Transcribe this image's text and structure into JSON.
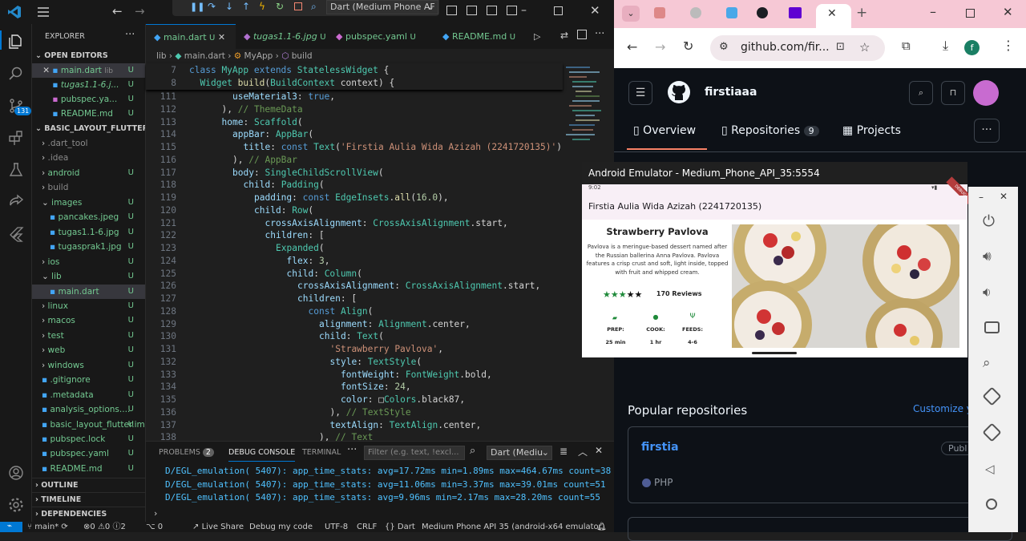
{
  "vscode": {
    "command_center": "Dart (Medium Phone AF",
    "explorer_title": "EXPLORER",
    "open_editors_label": "OPEN EDITORS",
    "open_editors": [
      {
        "name": "main.dart",
        "path": "lib",
        "status": "U"
      },
      {
        "name": "tugas1.1-6.j...",
        "path": "",
        "status": "U"
      },
      {
        "name": "pubspec.ya...",
        "path": "",
        "status": "U"
      },
      {
        "name": "README.md",
        "path": "",
        "status": "U"
      }
    ],
    "project_label": "BASIC_LAYOUT_FLUTTER",
    "tree": [
      {
        "name": ".dart_tool",
        "status": ""
      },
      {
        "name": ".idea",
        "status": ""
      },
      {
        "name": "android",
        "status": "U"
      },
      {
        "name": "build",
        "status": ""
      },
      {
        "name": "images",
        "status": "U"
      },
      {
        "name": "pancakes.jpeg",
        "status": "U"
      },
      {
        "name": "tugas1.1-6.jpg",
        "status": "U"
      },
      {
        "name": "tugasprak1.jpg",
        "status": "U"
      },
      {
        "name": "ios",
        "status": "U"
      },
      {
        "name": "lib",
        "status": "U"
      },
      {
        "name": "main.dart",
        "status": "U"
      },
      {
        "name": "linux",
        "status": "U"
      },
      {
        "name": "macos",
        "status": "U"
      },
      {
        "name": "test",
        "status": "U"
      },
      {
        "name": "web",
        "status": "U"
      },
      {
        "name": "windows",
        "status": "U"
      },
      {
        "name": ".gitignore",
        "status": "U"
      },
      {
        "name": ".metadata",
        "status": "U"
      },
      {
        "name": "analysis_options....",
        "status": "U"
      },
      {
        "name": "basic_layout_flutter.iml",
        "status": "U"
      },
      {
        "name": "pubspec.lock",
        "status": "U"
      },
      {
        "name": "pubspec.yaml",
        "status": "U"
      },
      {
        "name": "README.md",
        "status": "U"
      }
    ],
    "outline_label": "OUTLINE",
    "timeline_label": "TIMELINE",
    "dependencies_label": "DEPENDENCIES",
    "source_control_badge": "131",
    "tabs": [
      {
        "name": "main.dart",
        "status": "U"
      },
      {
        "name": "tugas1.1-6.jpg",
        "status": "U"
      },
      {
        "name": "pubspec.yaml",
        "status": "U"
      },
      {
        "name": "README.md",
        "status": "U"
      }
    ],
    "breadcrumb": [
      "lib",
      "main.dart",
      "MyApp",
      "build"
    ],
    "sticky_lines": [
      {
        "n": "7",
        "code": "class MyApp extends StatelessWidget {"
      },
      {
        "n": "8",
        "code": "  Widget build(BuildContext context) {"
      }
    ],
    "code_lines": [
      {
        "n": "111",
        "code": "        useMaterial3: true,"
      },
      {
        "n": "112",
        "code": "      ), // ThemeData"
      },
      {
        "n": "113",
        "code": "      home: Scaffold("
      },
      {
        "n": "114",
        "code": "        appBar: AppBar("
      },
      {
        "n": "115",
        "code": "          title: const Text('Firstia Aulia Wida Azizah (2241720135)'),"
      },
      {
        "n": "116",
        "code": "        ), // AppBar"
      },
      {
        "n": "117",
        "code": "        body: SingleChildScrollView("
      },
      {
        "n": "118",
        "code": "          child: Padding("
      },
      {
        "n": "119",
        "code": "            padding: const EdgeInsets.all(16.0),"
      },
      {
        "n": "120",
        "code": "            child: Row("
      },
      {
        "n": "121",
        "code": "              crossAxisAlignment: CrossAxisAlignment.start,"
      },
      {
        "n": "122",
        "code": "              children: ["
      },
      {
        "n": "123",
        "code": "                Expanded("
      },
      {
        "n": "124",
        "code": "                  flex: 3,"
      },
      {
        "n": "125",
        "code": "                  child: Column("
      },
      {
        "n": "126",
        "code": "                    crossAxisAlignment: CrossAxisAlignment.start,"
      },
      {
        "n": "127",
        "code": "                    children: ["
      },
      {
        "n": "128",
        "code": "                      const Align("
      },
      {
        "n": "129",
        "code": "                        alignment: Alignment.center,"
      },
      {
        "n": "130",
        "code": "                        child: Text("
      },
      {
        "n": "131",
        "code": "                          'Strawberry Pavlova',"
      },
      {
        "n": "132",
        "code": "                          style: TextStyle("
      },
      {
        "n": "133",
        "code": "                            fontWeight: FontWeight.bold,"
      },
      {
        "n": "134",
        "code": "                            fontSize: 24,"
      },
      {
        "n": "135",
        "code": "                            color: □Colors.black87,"
      },
      {
        "n": "136",
        "code": "                          ), // TextStyle"
      },
      {
        "n": "137",
        "code": "                          textAlign: TextAlign.center,"
      },
      {
        "n": "138",
        "code": "                        ), // Text"
      }
    ],
    "panel_tabs": [
      "PROBLEMS",
      "DEBUG CONSOLE",
      "TERMINAL"
    ],
    "problems_count": "2",
    "filter_placeholder": "Filter (e.g. text, !excl...",
    "debug_session": "Dart (Mediu",
    "console_lines": [
      "D/EGL_emulation( 5407): app_time_stats: avg=17.72ms min=1.89ms max=464.67ms count=38",
      "D/EGL_emulation( 5407): app_time_stats: avg=11.06ms min=3.37ms max=39.01ms count=51",
      "D/EGL_emulation( 5407): app_time_stats: avg=9.96ms min=2.17ms max=28.20ms count=55"
    ],
    "status": {
      "branch": "main*",
      "errors": "0",
      "warnings": "0",
      "info": "2",
      "ports": "0",
      "live_share": "Live Share",
      "debug_mode": "Debug my code",
      "encoding": "UTF-8",
      "eol": "CRLF",
      "language": "Dart",
      "device": "Medium Phone API 35 (android-x64 emulator)"
    }
  },
  "chrome": {
    "url": "github.com/fir...",
    "profile_initial": "f",
    "username": "firstiaaa",
    "nav_tabs": [
      {
        "label": "Overview",
        "count": ""
      },
      {
        "label": "Repositories",
        "count": "9"
      },
      {
        "label": "Projects",
        "count": ""
      }
    ],
    "popular_label": "Popular repositories",
    "customize_label": "Customize yo",
    "repo_name": "firstia",
    "repo_visibility": "Publ",
    "repo_language": "PHP"
  },
  "emulator": {
    "title": "Android Emulator - Medium_Phone_API_35:5554",
    "clock": "9:02",
    "debug_ribbon": "DEBUG",
    "app_title": "Firstia Aulia Wida Azizah (2241720135)",
    "card_title": "Strawberry Pavlova",
    "card_desc": "Pavlova is a meringue-based dessert named after the Russian ballerina Anna Pavlova. Pavlova features a crisp crust and soft, light inside, topped with fruit and whipped cream.",
    "rating": 3,
    "rating_max": 5,
    "reviews": "170 Reviews",
    "info": [
      {
        "label": "PREP:",
        "value": "25 min"
      },
      {
        "label": "COOK:",
        "value": "1 hr"
      },
      {
        "label": "FEEDS:",
        "value": "4-6"
      }
    ]
  },
  "colors": {
    "vscode_accent": "#0078d4",
    "untracked": "#73c991",
    "chrome_tab_strip": "#f6c8d5",
    "github_bg": "#0d1117",
    "github_link": "#4493f8",
    "star_green": "#1f8a3a",
    "php": "#4f5d95"
  }
}
